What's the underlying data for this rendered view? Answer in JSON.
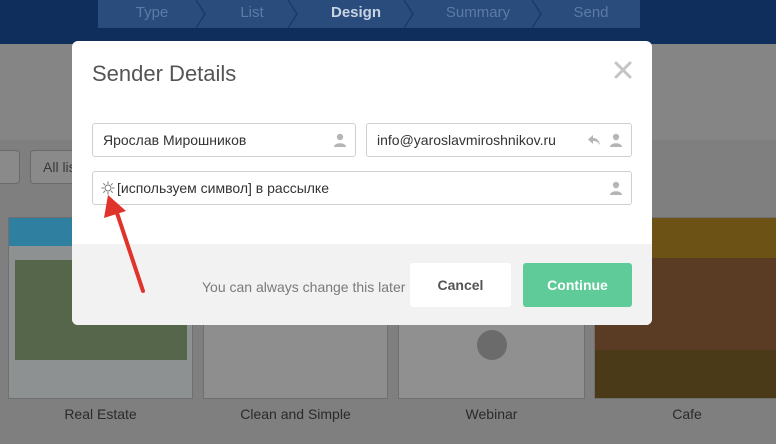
{
  "wizard": {
    "steps": [
      {
        "label": "Type"
      },
      {
        "label": "List"
      },
      {
        "label": "Design"
      },
      {
        "label": "Summary"
      },
      {
        "label": "Send"
      }
    ],
    "active_step": "Design"
  },
  "filters": {
    "all_lists_label": "All lis"
  },
  "templates": [
    {
      "label": "Real Estate"
    },
    {
      "label": "Clean and Simple"
    },
    {
      "label": "Webinar"
    },
    {
      "label": "Cafe"
    }
  ],
  "modal": {
    "title": "Sender Details",
    "close_icon": "close-icon",
    "sender_name": "Ярослав Мирошников",
    "sender_email": "info@yaroslavmiroshnikov.ru",
    "subject": "[используем символ] в рассылке",
    "subject_prefix_icon": "sun-icon",
    "footer_note": "You can always change this later",
    "cancel_label": "Cancel",
    "continue_label": "Continue"
  },
  "colors": {
    "continue_button": "#5ecb98",
    "annotation_arrow": "#e0332b",
    "header_bar": "#0f2e5c"
  }
}
